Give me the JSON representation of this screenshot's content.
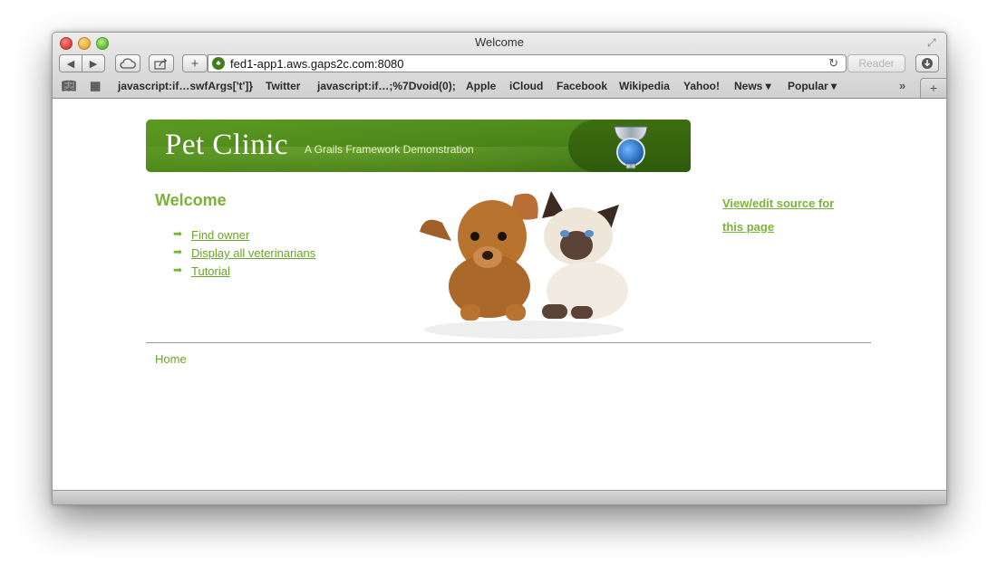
{
  "window": {
    "title": "Welcome"
  },
  "toolbar": {
    "url": "fed1-app1.aws.gaps2c.com:8080",
    "reader_label": "Reader",
    "back_glyph": "◀",
    "forward_glyph": "▶",
    "add_glyph": "+",
    "reload_glyph": "↻"
  },
  "bookmarks": [
    {
      "label": "javascript:if…swfArgs['t']}"
    },
    {
      "label": "Twitter"
    },
    {
      "label": "javascript:if…;%7Dvoid(0);"
    },
    {
      "label": "Apple"
    },
    {
      "label": "iCloud"
    },
    {
      "label": "Facebook"
    },
    {
      "label": "Wikipedia"
    },
    {
      "label": "Yahoo!"
    },
    {
      "label": "News ▾"
    },
    {
      "label": "Popular ▾"
    }
  ],
  "banner": {
    "title": "Pet Clinic",
    "subtitle": "A  Grails Framework Demonstration"
  },
  "main": {
    "heading": "Welcome",
    "menu": [
      {
        "label": "Find owner"
      },
      {
        "label": "Display all veterinarians"
      },
      {
        "label": "Tutorial"
      }
    ],
    "source_link": "View/edit source for this page"
  },
  "footer": {
    "home_link": "Home"
  },
  "colors": {
    "accent": "#7ab338",
    "banner": "#4e8a1a"
  }
}
